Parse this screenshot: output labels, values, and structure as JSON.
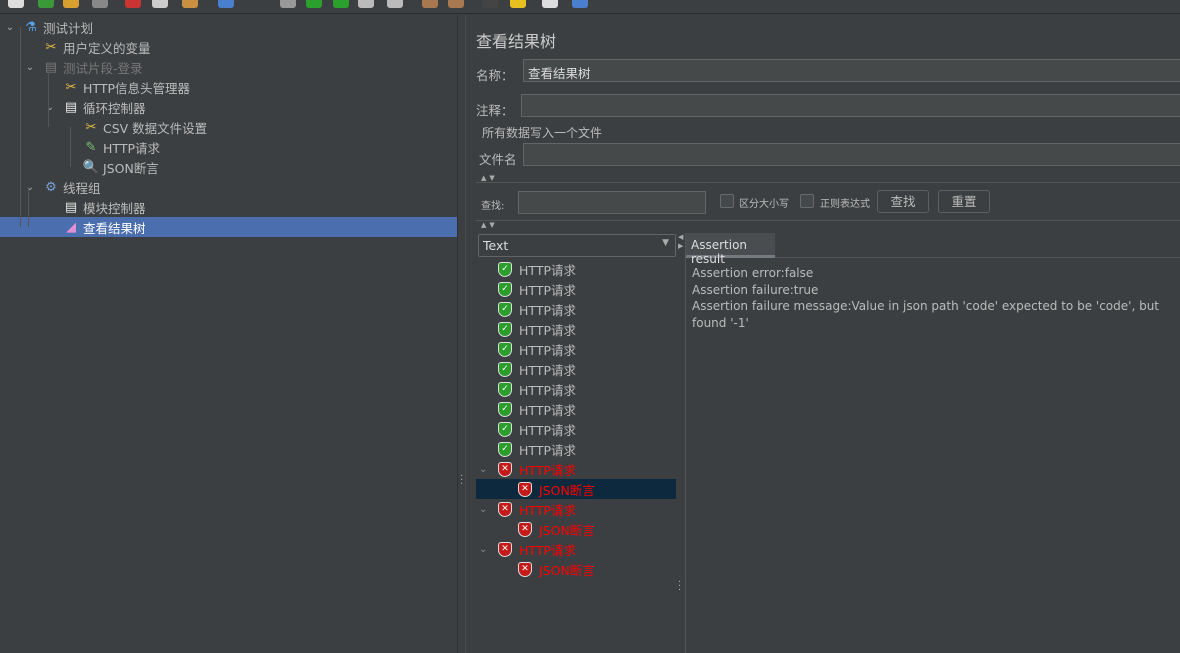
{
  "toolbar": {
    "icons": [
      "new-icon",
      "templates-icon",
      "open-icon",
      "save-icon",
      "cut-icon",
      "copy-icon",
      "paste-icon",
      "expand-icon",
      "toggle-icon",
      "start-icon",
      "start-no-pause-icon",
      "stop-icon",
      "shutdown-icon",
      "clear-icon",
      "clear-all-icon",
      "search-icon",
      "reset-search-icon",
      "function-helper-icon",
      "help-icon"
    ]
  },
  "tree": [
    {
      "label": "测试计划",
      "icon": "test-plan-icon",
      "level": 0,
      "expanded": true
    },
    {
      "label": "用户定义的变量",
      "icon": "config-tools-icon",
      "level": 1
    },
    {
      "label": "测试片段-登录",
      "icon": "test-fragment-icon",
      "level": 1,
      "expanded": true,
      "disabled": true
    },
    {
      "label": "HTTP信息头管理器",
      "icon": "config-tools-icon",
      "level": 2
    },
    {
      "label": "循环控制器",
      "icon": "controller-icon",
      "level": 2,
      "expanded": true
    },
    {
      "label": "CSV 数据文件设置",
      "icon": "config-tools-icon",
      "level": 3
    },
    {
      "label": "HTTP请求",
      "icon": "sampler-pipette-icon",
      "level": 3
    },
    {
      "label": "JSON断言",
      "icon": "assertion-magnifier-icon",
      "level": 3
    },
    {
      "label": "线程组",
      "icon": "thread-group-gear-icon",
      "level": 1,
      "expanded": true
    },
    {
      "label": "模块控制器",
      "icon": "controller-icon",
      "level": 2
    },
    {
      "label": "查看结果树",
      "icon": "listener-icon",
      "level": 2,
      "selected": true
    }
  ],
  "panel": {
    "title": "查看结果树",
    "name_label": "名称：",
    "name_value": "查看结果树",
    "comment_label": "注释：",
    "comment_value": "",
    "file_section": "所有数据写入一个文件",
    "filename_label": "文件名",
    "filename_value": "",
    "search_label": "查找:",
    "search_value": "",
    "case_label": "区分大小写",
    "regex_label": "正则表达式",
    "find_btn": "查找",
    "reset_btn": "重置",
    "renderer": "Text"
  },
  "results": [
    {
      "label": "HTTP请求",
      "status": "pass"
    },
    {
      "label": "HTTP请求",
      "status": "pass"
    },
    {
      "label": "HTTP请求",
      "status": "pass"
    },
    {
      "label": "HTTP请求",
      "status": "pass"
    },
    {
      "label": "HTTP请求",
      "status": "pass"
    },
    {
      "label": "HTTP请求",
      "status": "pass"
    },
    {
      "label": "HTTP请求",
      "status": "pass"
    },
    {
      "label": "HTTP请求",
      "status": "pass"
    },
    {
      "label": "HTTP请求",
      "status": "pass"
    },
    {
      "label": "HTTP请求",
      "status": "pass"
    },
    {
      "label": "HTTP请求",
      "status": "fail",
      "level": 0
    },
    {
      "label": "JSON断言",
      "status": "fail",
      "level": 1,
      "selected": true
    },
    {
      "label": "HTTP请求",
      "status": "fail",
      "level": 0
    },
    {
      "label": "JSON断言",
      "status": "fail",
      "level": 1
    },
    {
      "label": "HTTP请求",
      "status": "fail",
      "level": 0
    },
    {
      "label": "JSON断言",
      "status": "fail",
      "level": 1
    }
  ],
  "detail": {
    "tab": "Assertion result",
    "lines": [
      "Assertion error:false",
      "Assertion failure:true",
      "Assertion failure message:Value in json path 'code' expected to be 'code', but found '-1'"
    ]
  },
  "colors": {
    "background": "#3c3f41",
    "selection": "#4b6eaf",
    "result_selection": "#0d293e",
    "fail": "#ff0000",
    "pass": "#2a9d2a"
  }
}
